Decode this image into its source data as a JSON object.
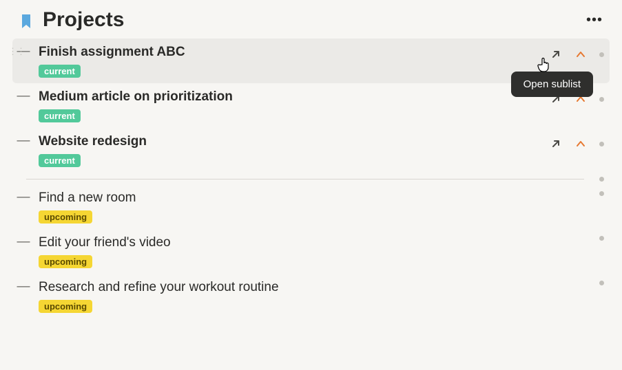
{
  "page_title": "Projects",
  "tooltip_text": "Open sublist",
  "tags": {
    "current": "current",
    "upcoming": "upcoming"
  },
  "items": [
    {
      "title": "Finish assignment ABC",
      "tag": "current",
      "hovered": true,
      "show_actions": true,
      "secondary": false
    },
    {
      "title": "Medium article on prioritization",
      "tag": "current",
      "hovered": false,
      "show_actions": true,
      "secondary": false
    },
    {
      "title": "Website redesign",
      "tag": "current",
      "hovered": false,
      "show_actions": true,
      "secondary": false
    },
    {
      "title": "Find a new room",
      "tag": "upcoming",
      "hovered": false,
      "show_actions": false,
      "secondary": true
    },
    {
      "title": "Edit your friend's video",
      "tag": "upcoming",
      "hovered": false,
      "show_actions": false,
      "secondary": true
    },
    {
      "title": "Research and refine your workout routine",
      "tag": "upcoming",
      "hovered": false,
      "show_actions": false,
      "secondary": true
    }
  ]
}
